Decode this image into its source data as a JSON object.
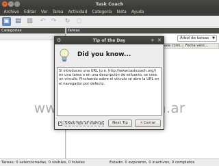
{
  "window": {
    "title": "Task Coach"
  },
  "menubar": [
    "Archivo",
    "Editar",
    "Ver",
    "Tarea",
    "Actividad",
    "Categoría",
    "Nota",
    "Ayuda"
  ],
  "left_panel": {
    "title": "Categories"
  },
  "right_panel": {
    "title": "Tareas",
    "tree_selector": "Árbol de tareas",
    "columns": [
      "...",
      "ade comi...",
      "Fecha venc..."
    ]
  },
  "statusbar": {
    "left": "Tareas: 0 seleccionadas, 0 visibles, 0 totales",
    "right": "Estado: 0 expiraron, 0 inactivos, 0 completos"
  },
  "dialog": {
    "title": "Tip of the Day",
    "headline": "Did you know...",
    "tip_text": "Si introduces una URL (p.e. http://www.taskcoach.org/) en una tarea o en una descripción de esfuerzo, se crea un vínculo. Pinchando sobre el vínculo se abre la URL en el navegador por defecto.",
    "show_tips_label": "Show tips at startup",
    "show_tips_checked": true,
    "next_button": "Next Tip",
    "close_button": "Cerrar"
  },
  "watermark": "www.ubuntips.com.ar",
  "colors": {
    "titlebar": "#3c3b37",
    "close_button": "#e26a3a",
    "panel_header": "#4a4a46"
  }
}
